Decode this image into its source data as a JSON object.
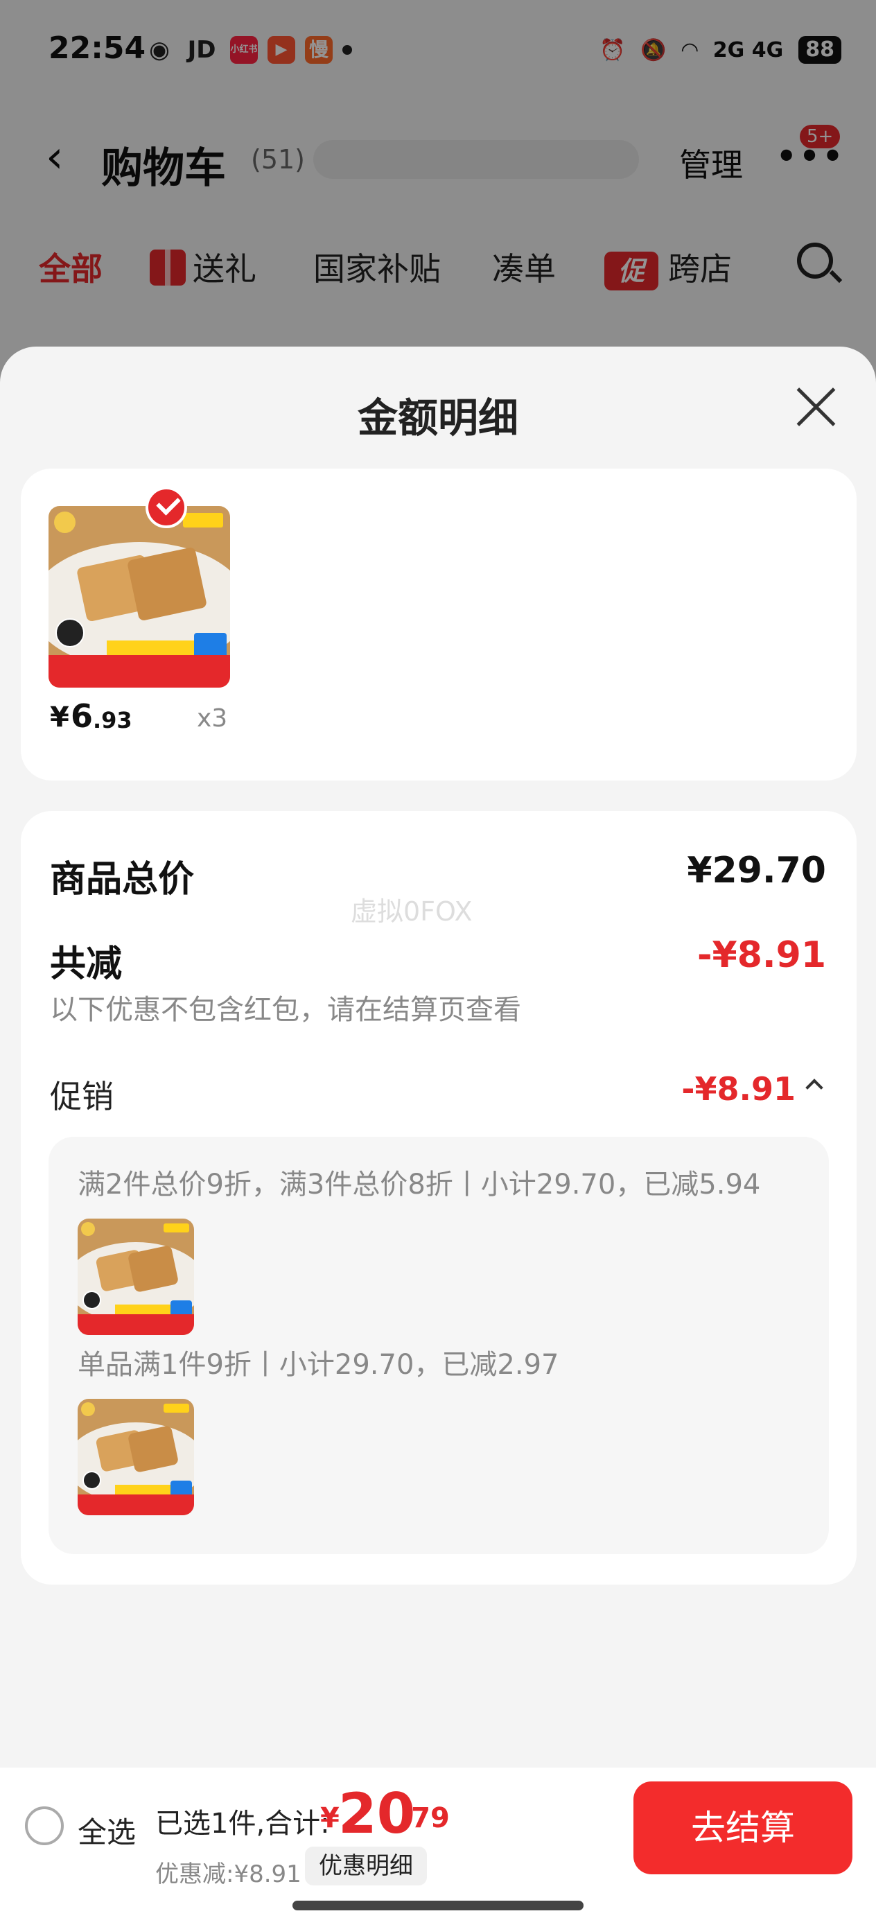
{
  "status_bar": {
    "time": "22:54",
    "jd_label": "JD",
    "app_badges": [
      "小红书",
      "▶",
      "慢"
    ],
    "network": "2G 4G",
    "battery": "88"
  },
  "nav": {
    "title": "购物车",
    "count": "(51)",
    "manage": "管理",
    "badge": "5+"
  },
  "tabs": [
    {
      "label": "全部"
    },
    {
      "label": "送礼"
    },
    {
      "label": "国家补贴"
    },
    {
      "label": "凑单"
    },
    {
      "label": "跨店"
    }
  ],
  "promo_tab_icon": "促",
  "sheet": {
    "title": "金额明细",
    "item": {
      "price_symbol": "¥",
      "price_int": "6",
      "price_dec": ".93",
      "quantity": "x3"
    },
    "summary": {
      "goods_total_label": "商品总价",
      "goods_total_value": "¥29.70",
      "reduced_label": "共减",
      "reduced_value": "-¥8.91",
      "note": "以下优惠不包含红包，请在结算页查看",
      "promo_label": "促销",
      "promo_value": "-¥8.91"
    },
    "promotions": [
      {
        "text": "满2件总价9折，满3件总价8折丨小计29.70，已减5.94"
      },
      {
        "text": "单品满1件9折丨小计29.70，已减2.97"
      }
    ],
    "watermark": "虚拟0FOX"
  },
  "checkout": {
    "select_all": "全选",
    "selected_text": "已选1件,合计:",
    "total_symbol": "¥",
    "total_int": "20",
    "total_dec": ".79",
    "discount_text": "优惠减:¥8.91",
    "detail_button": "优惠明细",
    "checkout_button": "去结算"
  },
  "colors": {
    "accent": "#e4282b",
    "checkout_button": "#f32c2c"
  }
}
